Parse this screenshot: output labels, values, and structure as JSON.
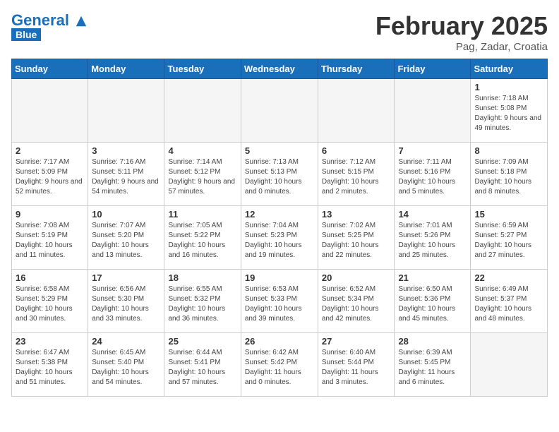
{
  "header": {
    "logo_general": "General",
    "logo_blue": "Blue",
    "month_title": "February 2025",
    "location": "Pag, Zadar, Croatia"
  },
  "weekdays": [
    "Sunday",
    "Monday",
    "Tuesday",
    "Wednesday",
    "Thursday",
    "Friday",
    "Saturday"
  ],
  "weeks": [
    [
      {
        "day": null
      },
      {
        "day": null
      },
      {
        "day": null
      },
      {
        "day": null
      },
      {
        "day": null
      },
      {
        "day": null
      },
      {
        "day": "1",
        "sunrise": "7:18 AM",
        "sunset": "5:08 PM",
        "daylight": "9 hours and 49 minutes."
      }
    ],
    [
      {
        "day": "2",
        "sunrise": "7:17 AM",
        "sunset": "5:09 PM",
        "daylight": "9 hours and 52 minutes."
      },
      {
        "day": "3",
        "sunrise": "7:16 AM",
        "sunset": "5:11 PM",
        "daylight": "9 hours and 54 minutes."
      },
      {
        "day": "4",
        "sunrise": "7:14 AM",
        "sunset": "5:12 PM",
        "daylight": "9 hours and 57 minutes."
      },
      {
        "day": "5",
        "sunrise": "7:13 AM",
        "sunset": "5:13 PM",
        "daylight": "10 hours and 0 minutes."
      },
      {
        "day": "6",
        "sunrise": "7:12 AM",
        "sunset": "5:15 PM",
        "daylight": "10 hours and 2 minutes."
      },
      {
        "day": "7",
        "sunrise": "7:11 AM",
        "sunset": "5:16 PM",
        "daylight": "10 hours and 5 minutes."
      },
      {
        "day": "8",
        "sunrise": "7:09 AM",
        "sunset": "5:18 PM",
        "daylight": "10 hours and 8 minutes."
      }
    ],
    [
      {
        "day": "9",
        "sunrise": "7:08 AM",
        "sunset": "5:19 PM",
        "daylight": "10 hours and 11 minutes."
      },
      {
        "day": "10",
        "sunrise": "7:07 AM",
        "sunset": "5:20 PM",
        "daylight": "10 hours and 13 minutes."
      },
      {
        "day": "11",
        "sunrise": "7:05 AM",
        "sunset": "5:22 PM",
        "daylight": "10 hours and 16 minutes."
      },
      {
        "day": "12",
        "sunrise": "7:04 AM",
        "sunset": "5:23 PM",
        "daylight": "10 hours and 19 minutes."
      },
      {
        "day": "13",
        "sunrise": "7:02 AM",
        "sunset": "5:25 PM",
        "daylight": "10 hours and 22 minutes."
      },
      {
        "day": "14",
        "sunrise": "7:01 AM",
        "sunset": "5:26 PM",
        "daylight": "10 hours and 25 minutes."
      },
      {
        "day": "15",
        "sunrise": "6:59 AM",
        "sunset": "5:27 PM",
        "daylight": "10 hours and 27 minutes."
      }
    ],
    [
      {
        "day": "16",
        "sunrise": "6:58 AM",
        "sunset": "5:29 PM",
        "daylight": "10 hours and 30 minutes."
      },
      {
        "day": "17",
        "sunrise": "6:56 AM",
        "sunset": "5:30 PM",
        "daylight": "10 hours and 33 minutes."
      },
      {
        "day": "18",
        "sunrise": "6:55 AM",
        "sunset": "5:32 PM",
        "daylight": "10 hours and 36 minutes."
      },
      {
        "day": "19",
        "sunrise": "6:53 AM",
        "sunset": "5:33 PM",
        "daylight": "10 hours and 39 minutes."
      },
      {
        "day": "20",
        "sunrise": "6:52 AM",
        "sunset": "5:34 PM",
        "daylight": "10 hours and 42 minutes."
      },
      {
        "day": "21",
        "sunrise": "6:50 AM",
        "sunset": "5:36 PM",
        "daylight": "10 hours and 45 minutes."
      },
      {
        "day": "22",
        "sunrise": "6:49 AM",
        "sunset": "5:37 PM",
        "daylight": "10 hours and 48 minutes."
      }
    ],
    [
      {
        "day": "23",
        "sunrise": "6:47 AM",
        "sunset": "5:38 PM",
        "daylight": "10 hours and 51 minutes."
      },
      {
        "day": "24",
        "sunrise": "6:45 AM",
        "sunset": "5:40 PM",
        "daylight": "10 hours and 54 minutes."
      },
      {
        "day": "25",
        "sunrise": "6:44 AM",
        "sunset": "5:41 PM",
        "daylight": "10 hours and 57 minutes."
      },
      {
        "day": "26",
        "sunrise": "6:42 AM",
        "sunset": "5:42 PM",
        "daylight": "11 hours and 0 minutes."
      },
      {
        "day": "27",
        "sunrise": "6:40 AM",
        "sunset": "5:44 PM",
        "daylight": "11 hours and 3 minutes."
      },
      {
        "day": "28",
        "sunrise": "6:39 AM",
        "sunset": "5:45 PM",
        "daylight": "11 hours and 6 minutes."
      },
      {
        "day": null
      }
    ]
  ]
}
